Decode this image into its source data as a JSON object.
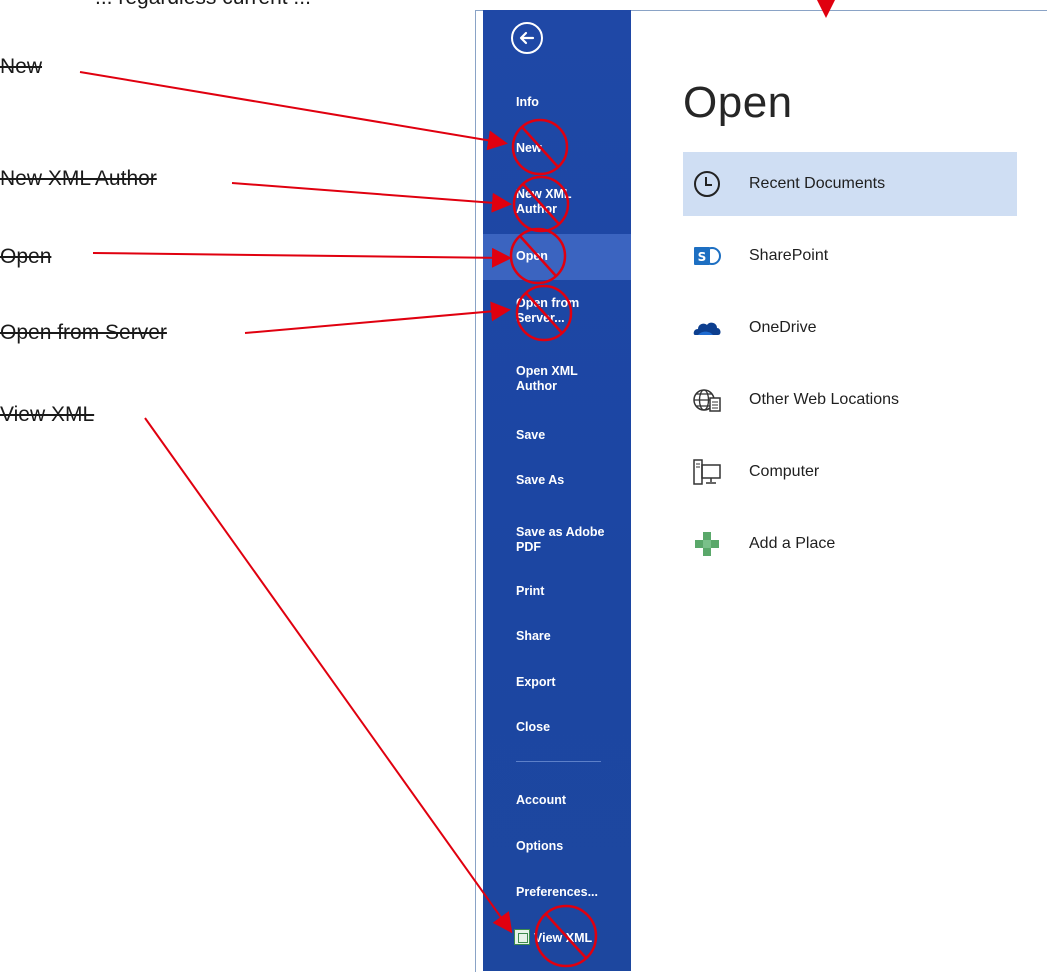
{
  "annotations": {
    "top_cut_text": "... regardless current ...",
    "labels": [
      "New",
      "New XML Author",
      "Open",
      "Open from Server",
      "View XML"
    ]
  },
  "backstage": {
    "back_icon": "back-arrow-icon",
    "nav_items": [
      {
        "label": "Info"
      },
      {
        "label": "New"
      },
      {
        "label": "New XML\nAuthor"
      },
      {
        "label": "Open"
      },
      {
        "label": "Open from\nServer..."
      },
      {
        "label": "Open XML\nAuthor"
      },
      {
        "label": "Save"
      },
      {
        "label": "Save As"
      },
      {
        "label": "Save as Adobe\nPDF"
      },
      {
        "label": "Print"
      },
      {
        "label": "Share"
      },
      {
        "label": "Export"
      },
      {
        "label": "Close"
      },
      {
        "label": "Account"
      },
      {
        "label": "Options"
      },
      {
        "label": "Preferences..."
      },
      {
        "label": "View XML",
        "icon": "xml-file-icon"
      }
    ],
    "active_item": "Open"
  },
  "main": {
    "title": "Open",
    "locations": [
      {
        "label": "Recent Documents",
        "icon": "clock-icon",
        "selected": true
      },
      {
        "label": "SharePoint",
        "icon": "sharepoint-icon"
      },
      {
        "label": "OneDrive",
        "icon": "cloud-icon"
      },
      {
        "label": "Other Web Locations",
        "icon": "globe-icon"
      },
      {
        "label": "Computer",
        "icon": "computer-icon"
      },
      {
        "label": "Add a Place",
        "icon": "plus-icon"
      }
    ]
  },
  "colors": {
    "sidebar": "#1f48a6",
    "sidebar_active": "#3b64c0",
    "selected_location": "#cfdef3",
    "annotation_red": "#e0000f"
  }
}
